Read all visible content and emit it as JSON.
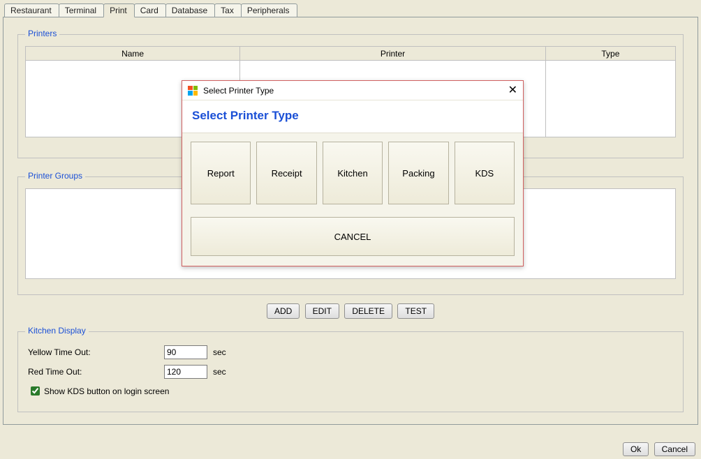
{
  "tabs": {
    "items": [
      "Restaurant",
      "Terminal",
      "Print",
      "Card",
      "Database",
      "Tax",
      "Peripherals"
    ],
    "active_index": 2
  },
  "printers": {
    "legend": "Printers",
    "columns": [
      "Name",
      "Printer",
      "Type"
    ]
  },
  "printer_groups": {
    "legend": "Printer Groups",
    "buttons": {
      "add": "ADD",
      "edit": "EDIT",
      "delete": "DELETE",
      "test": "TEST"
    }
  },
  "kds": {
    "legend": "Kitchen Display",
    "yellow_label": "Yellow Time Out:",
    "yellow_value": "90",
    "yellow_unit": "sec",
    "red_label": "Red Time Out:",
    "red_value": "120",
    "red_unit": "sec",
    "show_button_label": "Show KDS button on login screen",
    "show_button_checked": true
  },
  "footer": {
    "ok": "Ok",
    "cancel": "Cancel"
  },
  "modal": {
    "title": "Select Printer Type",
    "heading": "Select Printer Type",
    "options": [
      "Report",
      "Receipt",
      "Kitchen",
      "Packing",
      "KDS"
    ],
    "cancel": "CANCEL"
  }
}
